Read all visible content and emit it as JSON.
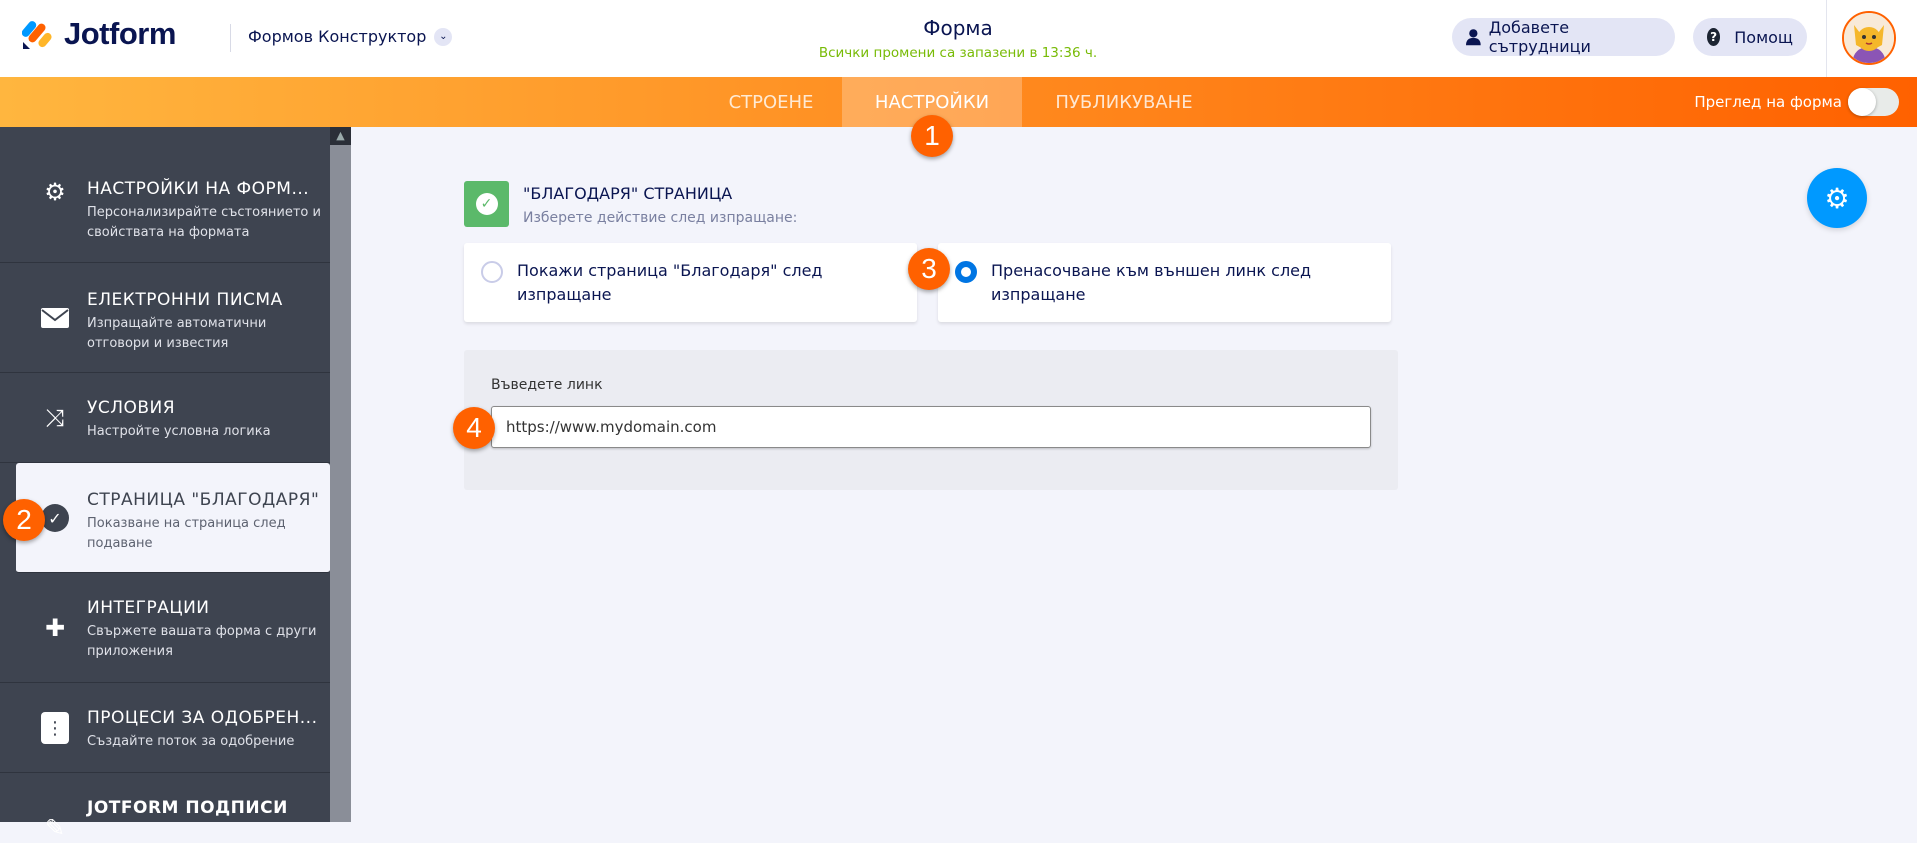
{
  "header": {
    "logo_text": "Jotform",
    "builder_label": "Формов Конструктор",
    "title": "Форма",
    "saved_status": "Всички промени са запазени в 13:36 ч.",
    "add_collaborators": "Добавете сътрудници",
    "help": "Помощ"
  },
  "nav": {
    "tabs": [
      {
        "label": "СТРОЕНЕ"
      },
      {
        "label": "НАСТРОЙКИ",
        "active": true
      },
      {
        "label": "ПУБЛИКУВАНЕ"
      }
    ],
    "preview_label": "Преглед на форма",
    "preview_on": false
  },
  "badges": [
    "1",
    "2",
    "3",
    "4"
  ],
  "sidebar": {
    "items": [
      {
        "title": "НАСТРОЙКИ НА ФОРМ...",
        "subtitle": "Персонализирайте състоянието и свойствата на формата",
        "icon": "gear-icon"
      },
      {
        "title": "ЕЛЕКТРОННИ ПИСМА",
        "subtitle": "Изпращайте автоматични отговори и известия",
        "icon": "envelope-icon"
      },
      {
        "title": "УСЛОВИЯ",
        "subtitle": "Настройте условна логика",
        "icon": "shuffle-icon"
      },
      {
        "title": "СТРАНИЦА \"БЛАГОДАРЯ\"",
        "subtitle": "Показване на страница след подаване",
        "icon": "check-circle-icon",
        "selected": true
      },
      {
        "title": "ИНТЕГРАЦИИ",
        "subtitle": "Свържете вашата форма с други приложения",
        "icon": "puzzle-icon"
      },
      {
        "title": "ПРОЦЕСИ ЗА ОДОБРЕН...",
        "subtitle": "Създайте поток за одобрение",
        "icon": "flowchart-icon"
      },
      {
        "title": "JOTFORM ПОДПИСИ",
        "subtitle": "",
        "icon": "signature-icon"
      }
    ]
  },
  "main": {
    "section_title": "\"БЛАГОДАРЯ\" СТРАНИЦА",
    "section_subtitle": "Изберете действие след изпращане:",
    "options": [
      {
        "label": "Покажи страница \"Благодаря\" след изпращане",
        "selected": false
      },
      {
        "label": "Пренасочване към външен линк след изпращане",
        "selected": true
      }
    ],
    "link_label": "Въведете линк",
    "link_value": "https://www.mydomain.com"
  },
  "colors": {
    "accent": "#ff6100",
    "blue": "#0099ff",
    "sidebar": "#3e4450",
    "green": "#5bb96a"
  }
}
